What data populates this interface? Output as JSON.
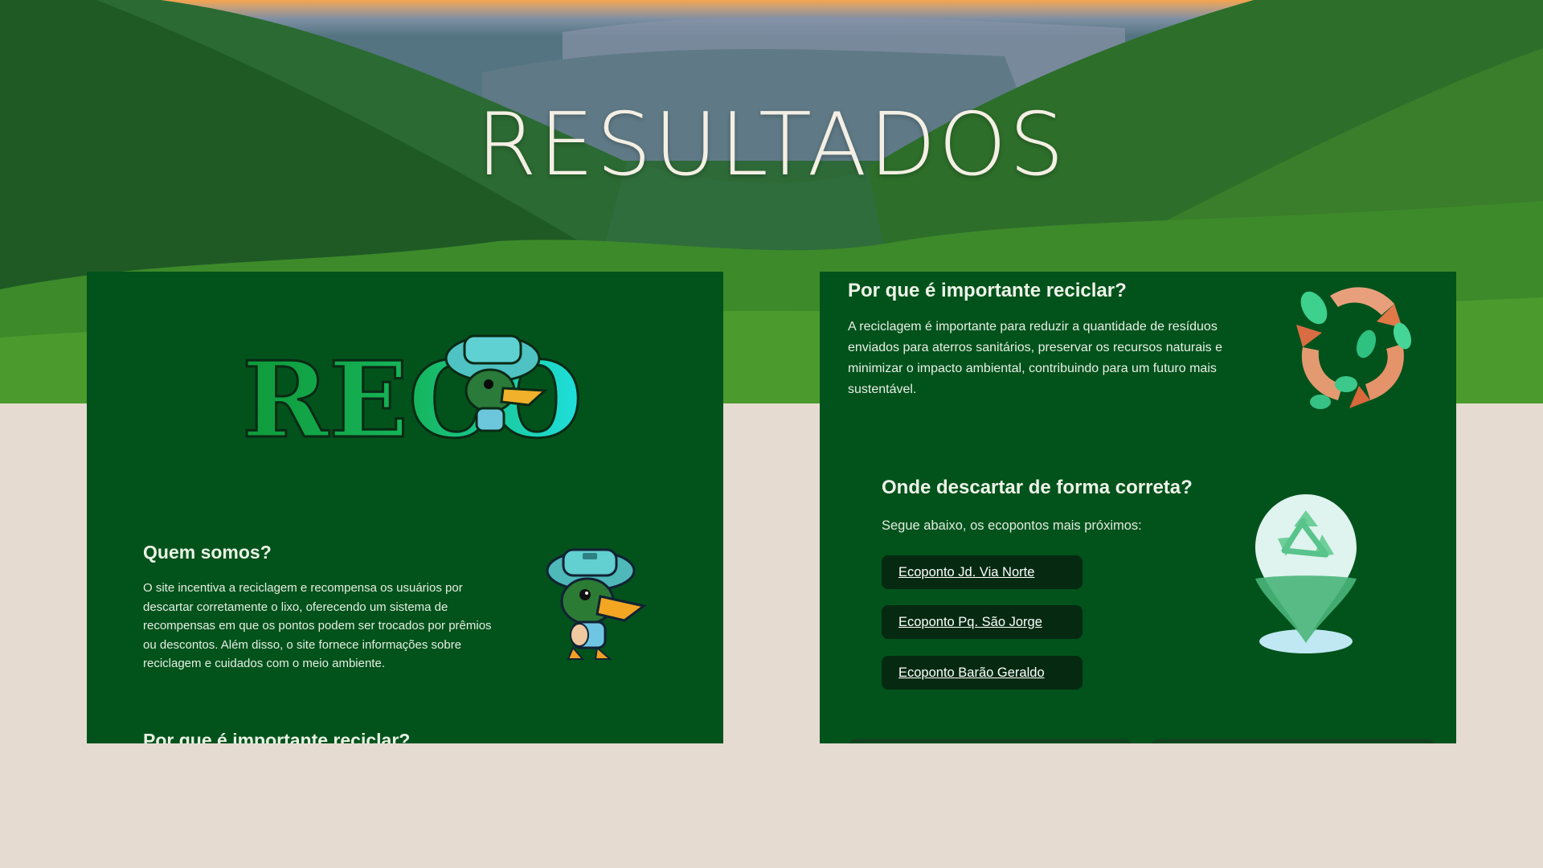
{
  "hero": {
    "title": "RESULTADOS"
  },
  "left_panel": {
    "logo_text": "RECO",
    "about_title": "Quem somos?",
    "about_text": "O site incentiva a reciclagem e recompensa os usuários por descartar corretamente o lixo, oferecendo um sistema de recompensas em que os pontos podem ser trocados por prêmios ou descontos. Além disso, o site fornece informações sobre reciclagem e cuidados com o meio ambiente.",
    "next_title": "Por que é importante reciclar?"
  },
  "right_panel": {
    "why_title": "Por que é importante reciclar?",
    "why_text": "A reciclagem é importante para reduzir a quantidade de resíduos enviados para aterros sanitários, preservar os recursos naturais e minimizar o impacto ambiental, contribuindo para um futuro mais sustentável.",
    "where_title": "Onde descartar de forma correta?",
    "where_text": "Segue abaixo, os ecopontos mais próximos:",
    "ecopontos": [
      {
        "label": "Ecoponto Jd. Via Norte"
      },
      {
        "label": "Ecoponto Pq. São Jorge"
      },
      {
        "label": "Ecoponto Barão Geraldo"
      }
    ]
  },
  "colors": {
    "page_background": "#e6dbd1",
    "panel_green": "#02521c",
    "button_dark": "#052a11",
    "title_cream": "#f4efe4"
  },
  "icons": [
    "reco-logo",
    "duck-mascot-icon",
    "recycle-leaves-icon",
    "recycle-location-pin-icon"
  ]
}
